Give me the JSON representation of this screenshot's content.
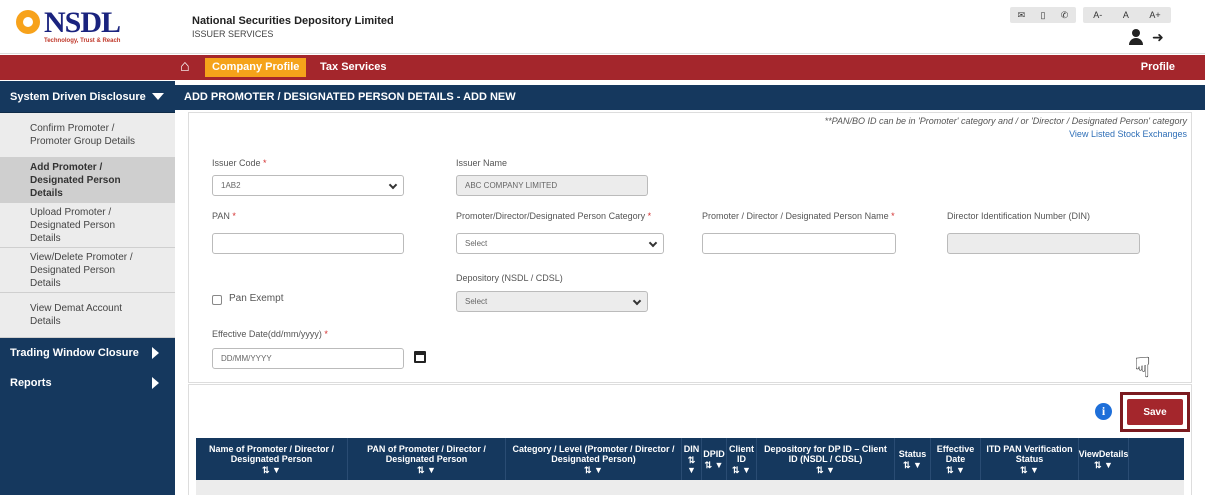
{
  "header": {
    "logo_text": "NSDL",
    "logo_tagline": "Technology, Trust & Reach",
    "org_name": "National Securities Depository Limited",
    "org_sub": "ISSUER SERVICES",
    "top_icons": [
      "✉",
      "▯",
      "✆"
    ],
    "font_sizes": [
      "A-",
      "A",
      "A+"
    ]
  },
  "nav": {
    "tabs": [
      {
        "label": "Company Profile",
        "active": true
      },
      {
        "label": "Tax Services",
        "active": false
      }
    ],
    "profile": "Profile"
  },
  "sidebar": {
    "section_open": "System Driven Disclosure",
    "items": [
      {
        "label": "Confirm Promoter / Promoter Group Details",
        "active": false
      },
      {
        "label": "Add Promoter / Designated Person Details",
        "active": true
      },
      {
        "label": "Upload Promoter / Designated Person Details",
        "active": false
      },
      {
        "label": "View/Delete Promoter / Designated Person Details",
        "active": false
      },
      {
        "label": "View Demat Account Details",
        "active": false
      }
    ],
    "sections": [
      "Trading Window Closure",
      "Reports"
    ]
  },
  "page": {
    "title": "ADD PROMOTER / DESIGNATED PERSON DETAILS - ADD NEW",
    "note": "**PAN/BO ID can be in 'Promoter' category and / or 'Director / Designated Person' category",
    "note_link": "View Listed Stock Exchanges"
  },
  "form": {
    "issuer_code_label": "Issuer Code",
    "issuer_code_value": "1AB2",
    "issuer_name_label": "Issuer Name",
    "issuer_name_value": "ABC COMPANY LIMITED",
    "pan_label": "PAN",
    "category_label": "Promoter/Director/Designated Person Category",
    "category_value": "Select",
    "name_label": "Promoter / Director / Designated Person Name",
    "din_label": "Director Identification Number (DIN)",
    "depository_label": "Depository (NSDL / CDSL)",
    "depository_value": "Select",
    "pan_exempt_label": "Pan Exempt",
    "effective_date_label": "Effective Date(dd/mm/yyyy)",
    "effective_date_placeholder": "DD/MM/YYYY",
    "required_mark": "*"
  },
  "actions": {
    "info": "i",
    "save": "Save"
  },
  "table": {
    "sort_icons": "⇅ ▼",
    "columns": [
      "Name of Promoter / Director / Designated Person",
      "PAN of Promoter / Director / Designated Person",
      "Category / Level (Promoter / Director / Designated Person)",
      "DIN",
      "DPID",
      "Client ID",
      "Depository for DP ID – Client ID (NSDL / CDSL)",
      "Status",
      "Effective Date",
      "ITD PAN Verification Status",
      "ViewDetails"
    ]
  }
}
